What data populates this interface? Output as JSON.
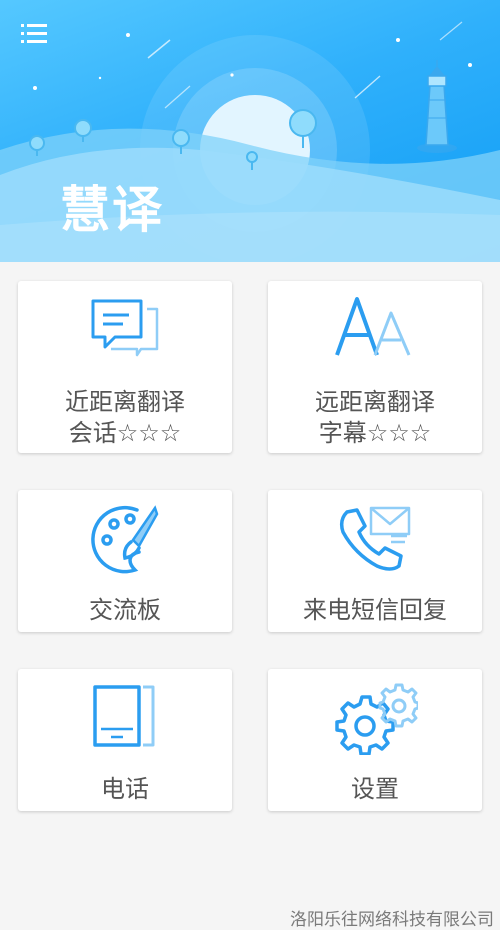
{
  "header": {
    "title": "慧译",
    "menu_icon": "menu-icon",
    "colors": {
      "top": "#55c8ff",
      "bottom": "#0f9cf5"
    }
  },
  "cards": [
    {
      "line1": "近距离翻译",
      "line2": "会话☆☆☆",
      "icon": "chat-bubbles-icon"
    },
    {
      "line1": "远距离翻译",
      "line2": "字幕☆☆☆",
      "icon": "font-size-icon"
    },
    {
      "label": "交流板",
      "icon": "palette-icon"
    },
    {
      "label": "来电短信回复",
      "icon": "phone-mail-icon"
    },
    {
      "label": "电话",
      "icon": "device-icon"
    },
    {
      "label": "设置",
      "icon": "gears-icon"
    }
  ],
  "accent_color": "#2b9df0",
  "footer": {
    "company": "洛阳乐往网络科技有限公司"
  }
}
